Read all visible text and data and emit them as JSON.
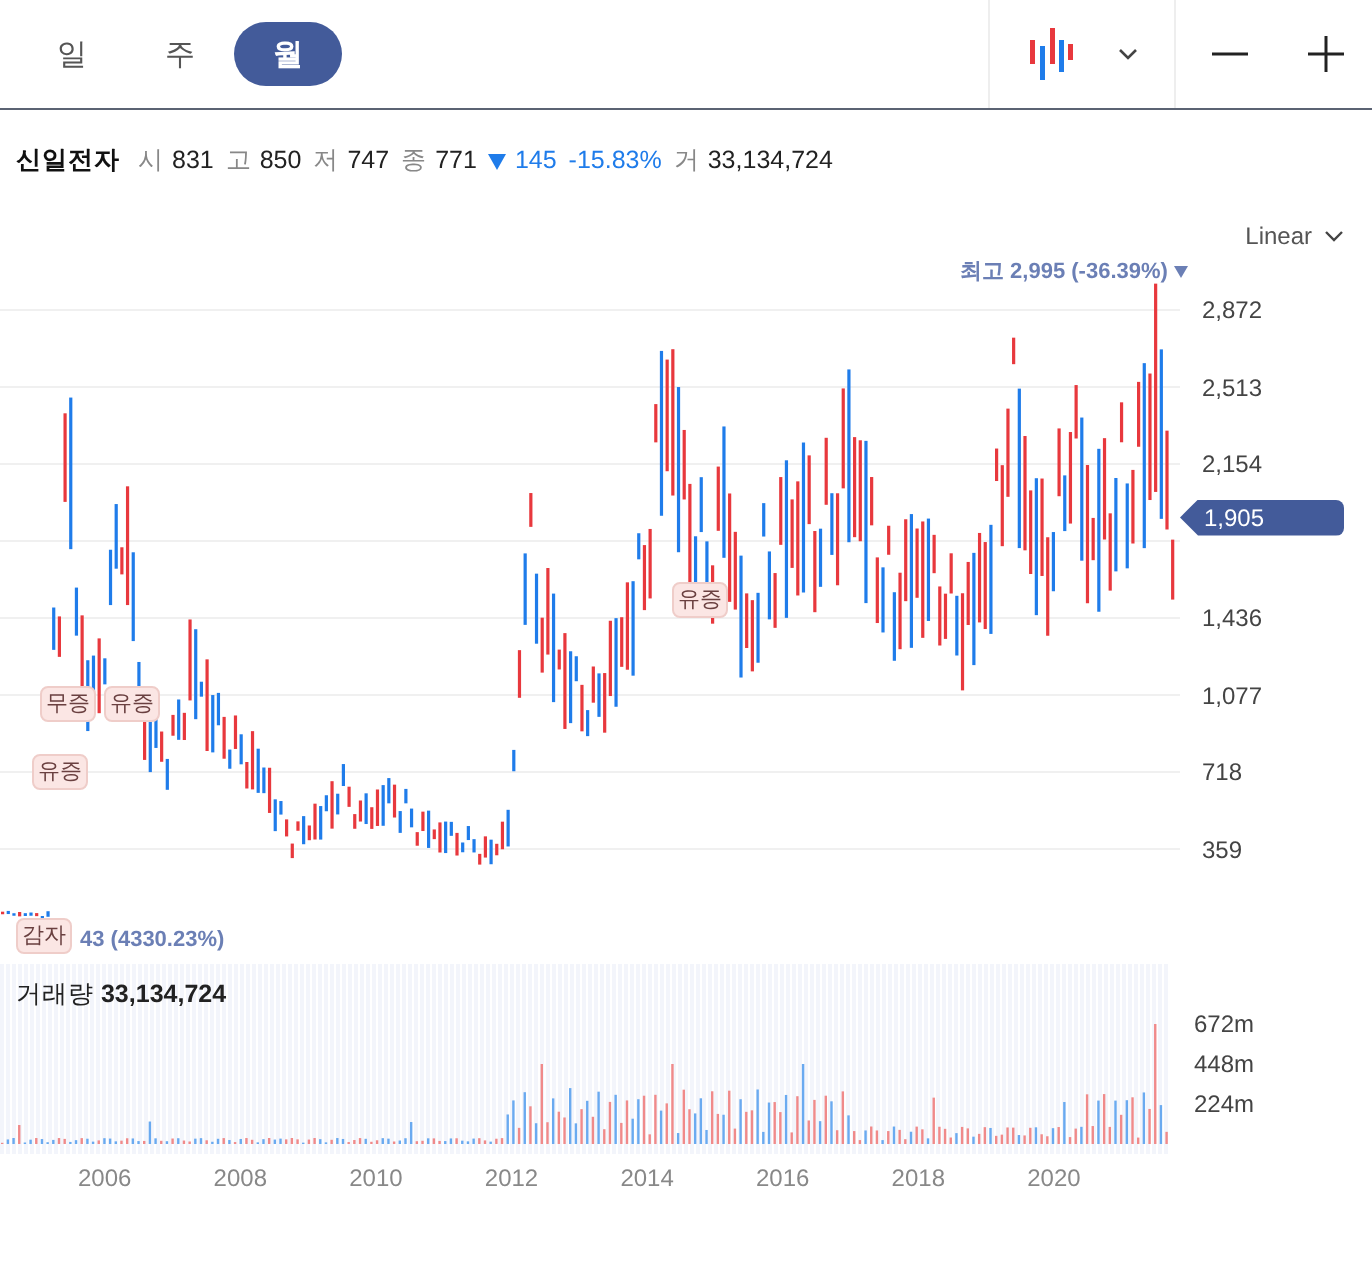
{
  "tabs": [
    {
      "label": "일",
      "selected": false
    },
    {
      "label": "주",
      "selected": false
    },
    {
      "label": "월",
      "selected": true
    }
  ],
  "quote": {
    "name": "신일전자",
    "fields": [
      {
        "label": "시",
        "value": "831"
      },
      {
        "label": "고",
        "value": "850"
      },
      {
        "label": "저",
        "value": "747"
      },
      {
        "label": "종",
        "value": "771"
      }
    ],
    "change": {
      "falling": true,
      "value": "145",
      "rate": "-15.83%"
    },
    "volume": {
      "label": "거",
      "value": "33,134,724"
    }
  },
  "scale_menu": {
    "label": "Linear"
  },
  "price_axis": {
    "ticks": [
      "2,872",
      "2,513",
      "2,154",
      "1,436",
      "1,077",
      "718",
      "359"
    ],
    "current_price": "1,905"
  },
  "high_marker": {
    "text": "최고 2,995 (-36.39%)"
  },
  "low_marker": {
    "text": "43 (4330.23%)"
  },
  "events": [
    {
      "label": "감자"
    },
    {
      "label": "유증"
    },
    {
      "label": "무증"
    },
    {
      "label": "유증"
    },
    {
      "label": "유증"
    }
  ],
  "volume_panel": {
    "label": "거래량",
    "value": "33,134,724",
    "ticks": [
      "672m",
      "448m",
      "224m"
    ]
  },
  "x_axis": {
    "labels": [
      "2006",
      "2008",
      "2010",
      "2012",
      "2014",
      "2016",
      "2018",
      "2020"
    ]
  }
}
